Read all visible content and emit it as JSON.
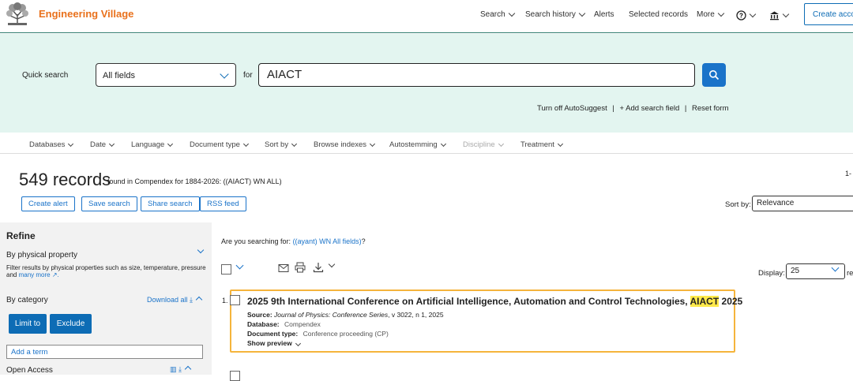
{
  "app": {
    "brand": "Engineering Village"
  },
  "nav": {
    "search": "Search",
    "search_history": "Search history",
    "alerts": "Alerts",
    "selected_records": "Selected records",
    "more": "More",
    "create_account": "Create accou"
  },
  "quick_search": {
    "label": "Quick search",
    "field": "All fields",
    "for_label": "for",
    "term": "AIACT",
    "turn_off_autosuggest": "Turn off AutoSuggest",
    "add_search_field": "+ Add search field",
    "reset_form": "Reset form",
    "separator": "|"
  },
  "filters": [
    {
      "label": "Databases",
      "disabled": false
    },
    {
      "label": "Date",
      "disabled": false
    },
    {
      "label": "Language",
      "disabled": false
    },
    {
      "label": "Document type",
      "disabled": false
    },
    {
      "label": "Sort by",
      "disabled": false
    },
    {
      "label": "Browse indexes",
      "disabled": false
    },
    {
      "label": "Autostemming",
      "disabled": false
    },
    {
      "label": "Discipline",
      "disabled": true
    },
    {
      "label": "Treatment",
      "disabled": false
    }
  ],
  "results_header": {
    "count": "549 records",
    "found_text": "found in Compendex for 1884-2026: ((AIACT) WN ALL)",
    "pager": "1-",
    "actions": [
      "Create alert",
      "Save search",
      "Share search",
      "RSS feed"
    ],
    "sort_by_label": "Sort by:",
    "sort_by_value": "Relevance"
  },
  "refine": {
    "title": "Refine",
    "physical_property": {
      "title": "By physical property",
      "description": "Filter results by physical properties such as size, temperature, pressure and",
      "more_link": "many more ↗."
    },
    "category": {
      "title": "By category",
      "download_all": "Download all",
      "limit_to": "Limit to",
      "exclude": "Exclude",
      "add_term": "Add a term"
    },
    "open_access": "Open Access"
  },
  "suggestion": {
    "prefix": "Are you searching for:",
    "link": "((ayant) WN All fields)",
    "suffix": "?"
  },
  "display": {
    "label": "Display:",
    "value": "25",
    "suffix": "res"
  },
  "results": [
    {
      "number": "1.",
      "title_before": "2025 9th International Conference on Artificial Intelligence, Automation and Control Technologies, ",
      "title_highlight": "AIACT",
      "title_after": " 2025",
      "source_label": "Source:",
      "source_journal": "Journal of Physics: Conference Series",
      "source_rest": ", v 3022, n 1, 2025",
      "database_label": "Database:",
      "database_value": "Compendex",
      "doctype_label": "Document type:",
      "doctype_value": "Conference proceeding (CP)",
      "show_preview": "Show preview"
    }
  ],
  "colors": {
    "brand": "#e9711c",
    "accent": "#1a73c9",
    "highlight": "#ffe94a",
    "card_border": "#f5b43c",
    "search_band": "#e3f5f0"
  }
}
